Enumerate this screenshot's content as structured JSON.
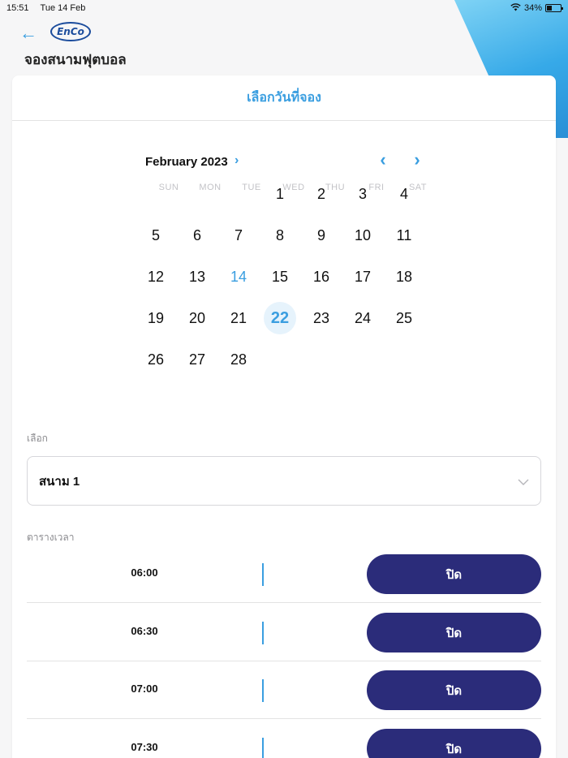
{
  "status_bar": {
    "time": "15:51",
    "date": "Tue 14 Feb",
    "battery": "34%"
  },
  "header": {
    "logo_text": "EnCo",
    "title": "จองสนามฟุตบอล"
  },
  "card": {
    "title": "เลือกวันที่จอง"
  },
  "calendar": {
    "month_label": "February 2023",
    "weekdays": [
      "SUN",
      "MON",
      "TUE",
      "WED",
      "THU",
      "FRI",
      "SAT"
    ],
    "weeks": [
      [
        "",
        "",
        "",
        "1",
        "2",
        "3",
        "4"
      ],
      [
        "5",
        "6",
        "7",
        "8",
        "9",
        "10",
        "11"
      ],
      [
        "12",
        "13",
        "14",
        "15",
        "16",
        "17",
        "18"
      ],
      [
        "19",
        "20",
        "21",
        "22",
        "23",
        "24",
        "25"
      ],
      [
        "26",
        "27",
        "28",
        "",
        "",
        "",
        ""
      ]
    ],
    "today": "14",
    "selected": "22"
  },
  "field_select": {
    "label": "เลือก",
    "value": "สนาม 1"
  },
  "schedule": {
    "label": "ตารางเวลา",
    "slots": [
      {
        "time": "06:00",
        "status": "ปิด"
      },
      {
        "time": "06:30",
        "status": "ปิด"
      },
      {
        "time": "07:00",
        "status": "ปิด"
      },
      {
        "time": "07:30",
        "status": "ปิด"
      }
    ]
  },
  "colors": {
    "accent": "#3a9ee0",
    "button": "#2b2c7a",
    "selected_bg": "#e6f3fc"
  }
}
